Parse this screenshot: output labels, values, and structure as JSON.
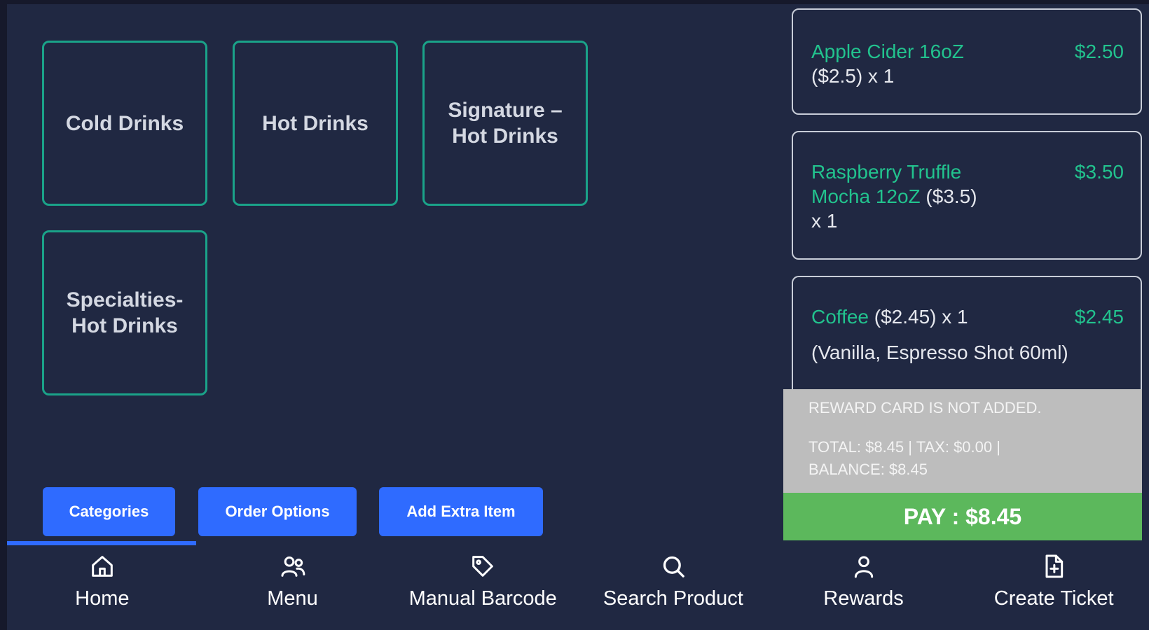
{
  "categories": [
    {
      "label": "Cold Drinks"
    },
    {
      "label": "Hot Drinks"
    },
    {
      "label": "Signature – Hot Drinks"
    },
    {
      "label": "Specialties- Hot Drinks"
    }
  ],
  "actions": {
    "categories_label": "Categories",
    "order_options_label": "Order Options",
    "add_extra_item_label": "Add Extra Item"
  },
  "order": {
    "items": [
      {
        "name": "Apple Cider 16oZ",
        "detail": "($2.5) x 1",
        "price": "$2.50"
      },
      {
        "name": "Raspberry Truffle",
        "name2": "Mocha 12oZ",
        "detail": "($3.5)",
        "detail2": "x 1",
        "price": "$3.50"
      },
      {
        "name": "Coffee",
        "detail": "($2.45) x 1",
        "modifiers": "(Vanilla, Espresso Shot 60ml)",
        "price": "$2.45"
      }
    ],
    "reward_status": "REWARD CARD IS NOT ADDED.",
    "totals_line1": "TOTAL: $8.45  |  TAX: $0.00  |",
    "totals_line2": "BALANCE: $8.45",
    "pay_label": "PAY : $8.45"
  },
  "nav": {
    "items": [
      {
        "label": "Home",
        "icon": "home-icon"
      },
      {
        "label": "Menu",
        "icon": "users-icon"
      },
      {
        "label": "Manual Barcode",
        "icon": "tag-icon"
      },
      {
        "label": "Search Product",
        "icon": "search-icon"
      },
      {
        "label": "Rewards",
        "icon": "user-icon"
      },
      {
        "label": "Create Ticket",
        "icon": "file-plus-icon"
      }
    ]
  },
  "colors": {
    "background": "#202842",
    "accent_border": "#1aa389",
    "button_blue": "#2f6bff",
    "item_green": "#22c38e",
    "pay_green": "#5cb85c",
    "totals_gray": "#bdbdbd"
  }
}
